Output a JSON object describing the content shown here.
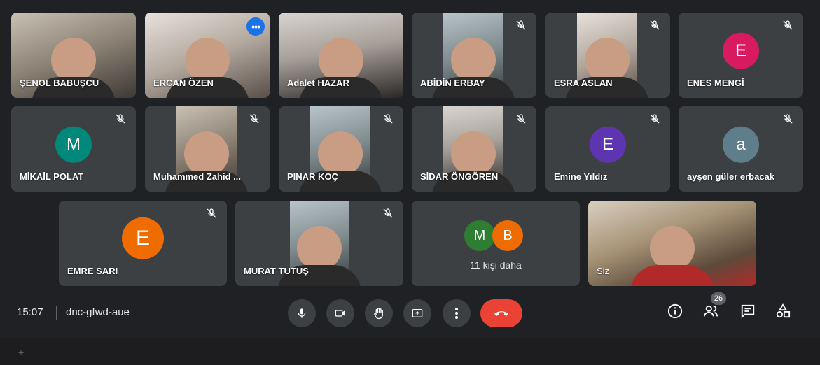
{
  "participants": [
    {
      "name": "ŞENOL BABUŞCU"
    },
    {
      "name": "ERCAN ÖZEN"
    },
    {
      "name": "Adalet HAZAR"
    },
    {
      "name": "ABİDİN ERBAY"
    },
    {
      "name": "ESRA ASLAN"
    },
    {
      "name": "ENES MENGİ",
      "initial": "E",
      "color": "#d81b60"
    },
    {
      "name": "MİKAİL POLAT",
      "initial": "M",
      "color": "#00897b"
    },
    {
      "name": "Muhammed Zahid ..."
    },
    {
      "name": "PINAR KOÇ"
    },
    {
      "name": "SİDAR ÖNGÖREN"
    },
    {
      "name": "Emine Yıldız",
      "initial": "E",
      "color": "#5e35b1"
    },
    {
      "name": "ayşen güler erbacak",
      "initial": "a",
      "color": "#607d8b"
    },
    {
      "name": "EMRE SARI",
      "initial": "E",
      "color": "#ef6c00"
    },
    {
      "name": "MURAT TUTUŞ"
    }
  ],
  "more": {
    "label": "11 kişi daha",
    "avatars": [
      {
        "initial": "M",
        "color": "#2e7d32"
      },
      {
        "initial": "B",
        "color": "#ef6c00"
      }
    ]
  },
  "self": {
    "label": "Siz"
  },
  "meeting": {
    "time": "15:07",
    "code": "dnc-gfwd-aue"
  },
  "people_count": "26",
  "tile_menu": "•••",
  "footer_plus": "+"
}
